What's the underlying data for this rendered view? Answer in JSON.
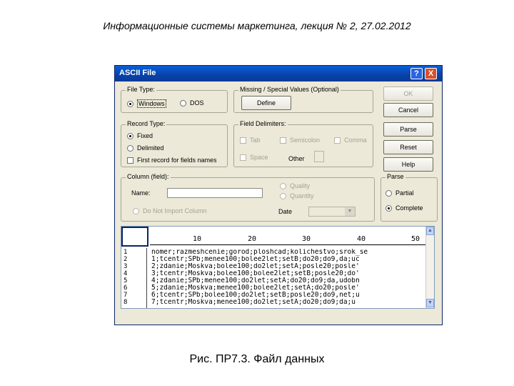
{
  "slide": {
    "title": "Информационные системы маркетинга, лекция № 2, 27.02.2012",
    "caption": "Рис. ПР7.3. Файл данных"
  },
  "window": {
    "title": "ASCII File",
    "help_glyph": "?",
    "close_glyph": "X"
  },
  "file_type": {
    "label": "File Type:",
    "options": [
      "Windows",
      "DOS"
    ],
    "selected": "Windows"
  },
  "missing": {
    "label": "Missing / Special Values (Optional)",
    "define_label": "Define"
  },
  "record_type": {
    "label": "Record Type:",
    "fixed": "Fixed",
    "delimited": "Delimited",
    "first_record": "First record for fields names",
    "selected": "Fixed"
  },
  "delimiters": {
    "label": "Field Delimiters:",
    "tab": "Tab",
    "semicolon": "Semicolon",
    "comma": "Comma",
    "space": "Space",
    "other": "Other"
  },
  "buttons": {
    "ok": "OK",
    "cancel": "Cancel",
    "parse": "Parse",
    "reset": "Reset",
    "help": "Help"
  },
  "column": {
    "label": "Column (field):",
    "name_label": "Name:",
    "quality": "Quality",
    "quantity": "Quantity",
    "do_not_import": "Do Not Import Column",
    "date_label": "Date",
    "date_arrow": "▼"
  },
  "parse_group": {
    "label": "Parse",
    "partial": "Partial",
    "complete": "Complete",
    "selected": "Complete"
  },
  "preview": {
    "ruler": [
      "10",
      "20",
      "30",
      "40",
      "50"
    ],
    "row_numbers": [
      "1",
      "2",
      "3",
      "4",
      "5",
      "6",
      "7",
      "8"
    ],
    "lines": [
      "nomer;razmeshcenie;gorod;ploshcad;kolichestvo;srok_se",
      "1;tcentr;SPb;menee100;bolee2let;setB;do20;do9,da;uc",
      "2;zdanie;Moskva;bolee100;do2let;setA;posle20;posle'",
      "3;tcentr;Moskva;bolee100;bolee2let;setB;posle20;do'",
      "4;zdanie;SPb;menee100;do2let;setA;do20;do9;da,udobn",
      "5;zdanie;Moskva;menee100;bolee2let;setA;do20;posle'",
      "6;tcentr;SPb;bolee100;do2let;setB;posle20;do9,net;u",
      "7;tcentr;Moskva;menee100;do2let;setA;do20;do9;da;u"
    ],
    "scroll_up": "▲",
    "scroll_down": "▼"
  }
}
